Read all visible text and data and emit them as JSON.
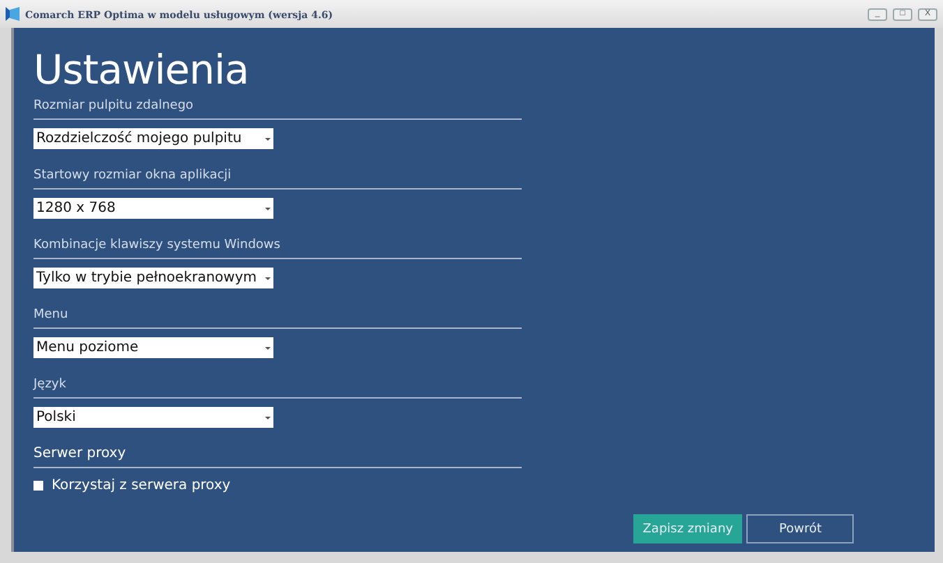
{
  "window": {
    "title": "Comarch ERP Optima w modelu usługowym (wersja 4.6)",
    "controls": [
      "_",
      "□",
      "X"
    ]
  },
  "heading": "Ustawienia",
  "sections": [
    {
      "label": "Rozmiar pulpitu zdalnego",
      "kind": "select",
      "value": "Rozdzielczość mojego pulpitu"
    },
    {
      "label": "Startowy rozmiar okna aplikacji",
      "kind": "select",
      "value": "1280 x 768"
    },
    {
      "label": "Kombinacje klawiszy systemu Windows",
      "kind": "select",
      "value": "Tylko w trybie pełnoekranowym"
    },
    {
      "label": "Menu",
      "kind": "select",
      "value": "Menu poziome"
    },
    {
      "label": "Język",
      "kind": "select",
      "value": "Polski"
    },
    {
      "label": "Serwer proxy",
      "kind": "checkbox",
      "value": "Korzystaj z serwera proxy",
      "checked": false
    }
  ],
  "buttons": [
    {
      "label": "Zapisz zmiany",
      "kind": "primary"
    },
    {
      "label": "Powrót",
      "kind": "secondary"
    }
  ]
}
